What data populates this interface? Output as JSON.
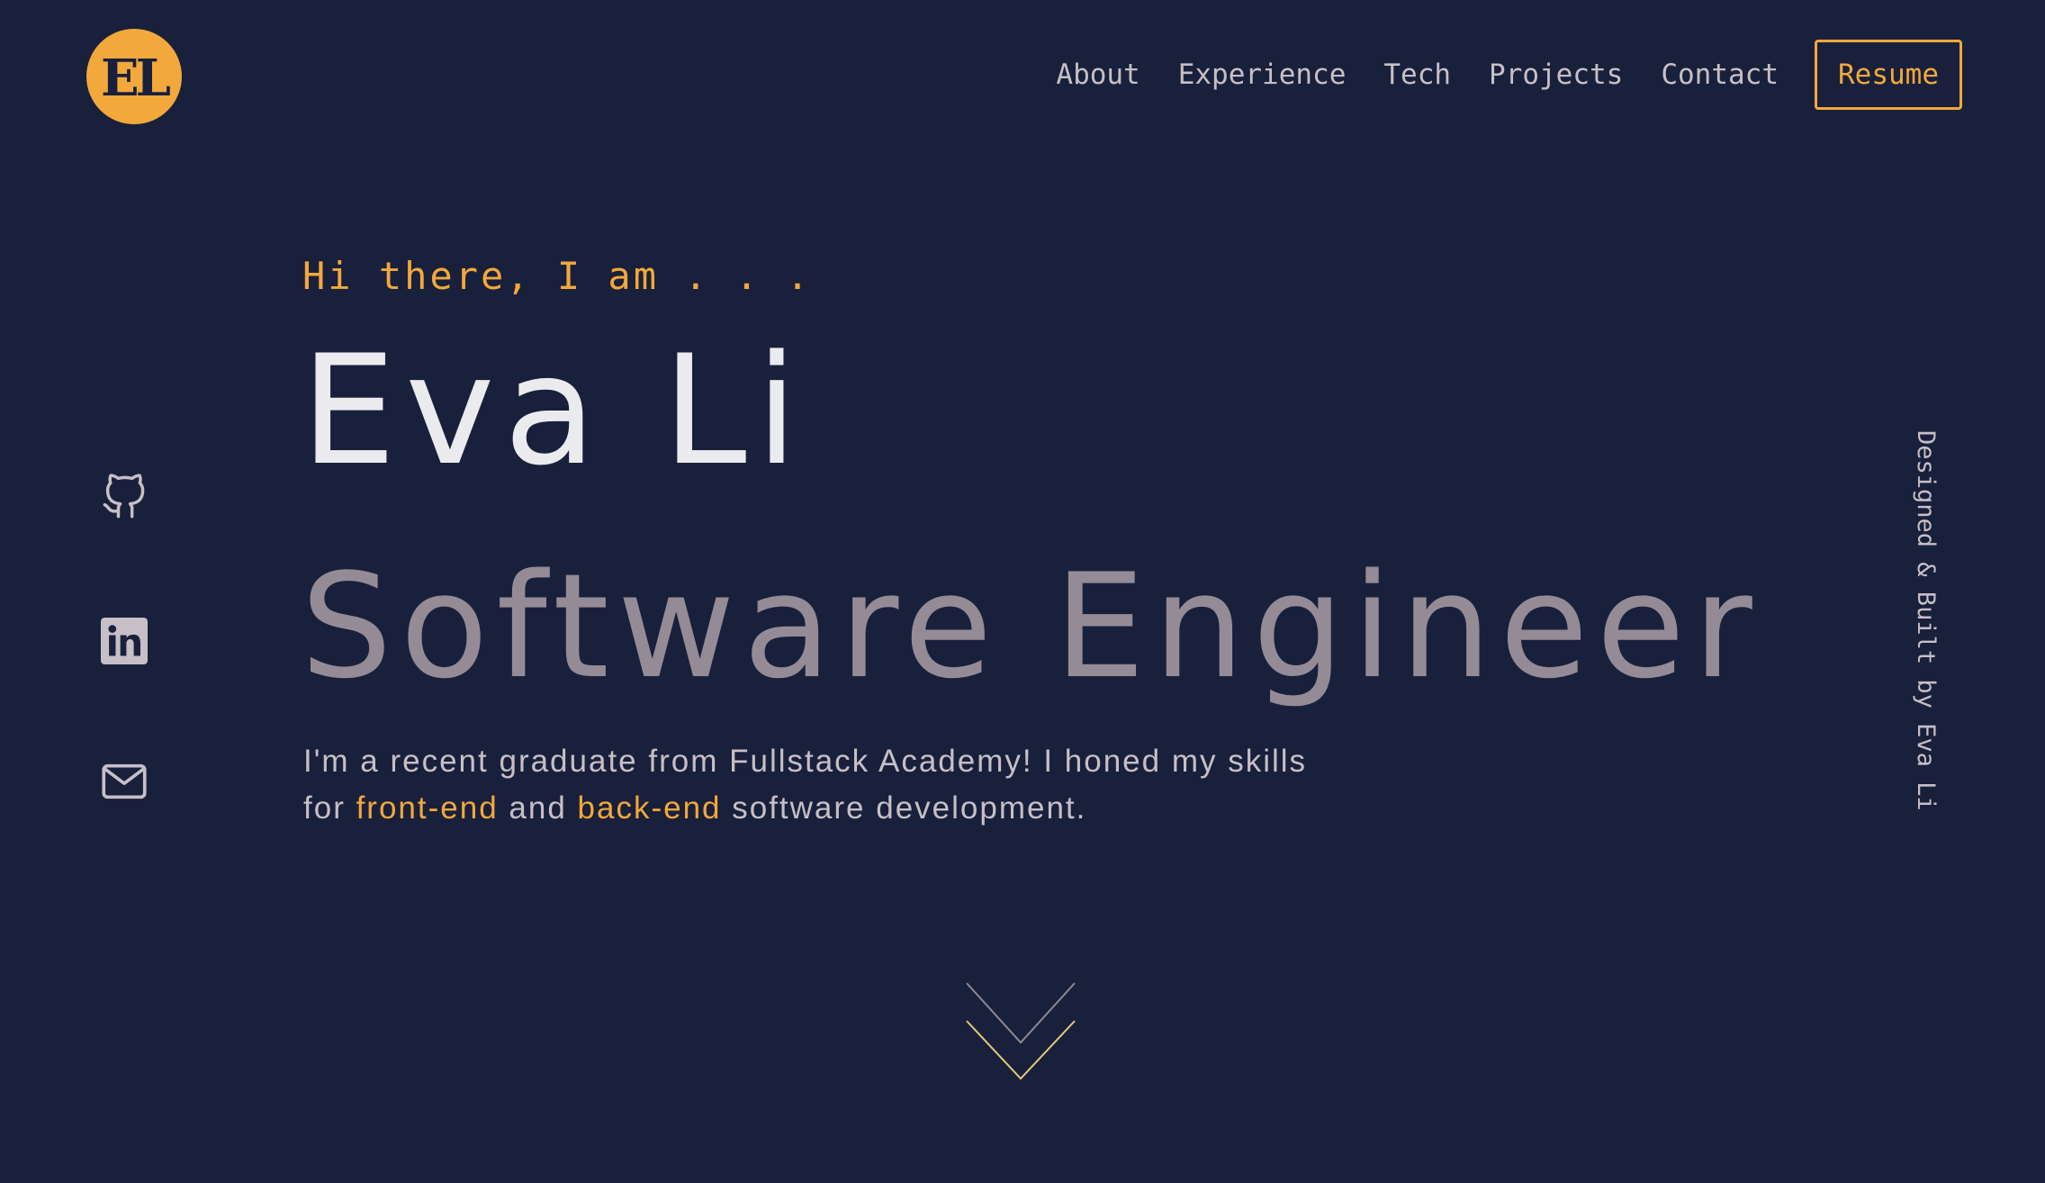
{
  "logo": {
    "text": "EL"
  },
  "nav": {
    "links": [
      "About",
      "Experience",
      "Tech",
      "Projects",
      "Contact"
    ],
    "resume_label": "Resume"
  },
  "social": {
    "icons": [
      "github-icon",
      "linkedin-icon",
      "mail-icon"
    ]
  },
  "hero": {
    "greeting": "Hi there, I am . . .",
    "name": "Eva Li",
    "role": "Software Engineer",
    "intro": {
      "part1": "I'm a recent graduate from Fullstack Academy! I honed my skills for ",
      "highlight1": "front-end",
      "part2": " and ",
      "highlight2": "back-end",
      "part3": " software development."
    }
  },
  "credit": "Designed & Built by Eva Li",
  "scroll": {
    "icon": "chevron-down-icon"
  },
  "colors": {
    "background": "#19203c",
    "accent": "#f2a83b",
    "text_light": "#ebebef",
    "text_muted": "#c7bfc7",
    "role_text": "#958b97"
  }
}
